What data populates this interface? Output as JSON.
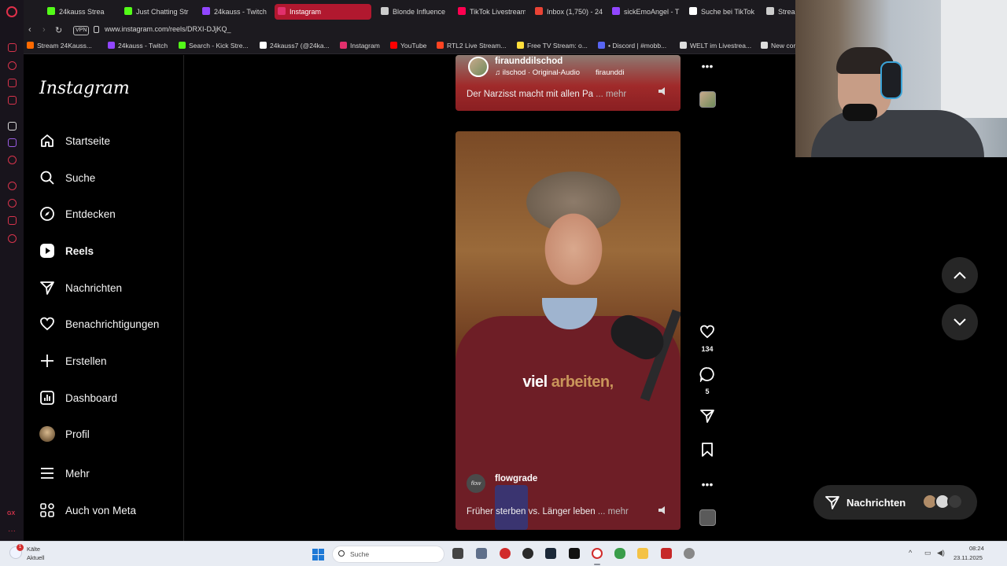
{
  "browser": {
    "tabs": [
      {
        "label": "24kauss Strea",
        "color": "#53fc18"
      },
      {
        "label": "Just Chatting Str",
        "color": "#53fc18"
      },
      {
        "label": "24kauss - Twitch",
        "color": "#9146ff"
      },
      {
        "label": "Instagram",
        "color": "#e1306c"
      },
      {
        "label": "Blonde Influence",
        "color": "#cccccc"
      },
      {
        "label": "TikTok Livestream",
        "color": "#ff0050"
      },
      {
        "label": "Inbox (1,750) - 24",
        "color": "#ea4335"
      },
      {
        "label": "sickEmoAngel - T",
        "color": "#9146ff"
      },
      {
        "label": "Suche bei TikTok",
        "color": "#ffffff"
      },
      {
        "label": "Strea",
        "color": "#cccccc"
      }
    ],
    "vpn": "VPN",
    "url": "www.instagram.com/reels/DRXI-DJjKQ_",
    "bookmarks": [
      {
        "label": "Stream 24Kauss...",
        "color": "#ff6a00"
      },
      {
        "label": "24kauss - Twitch",
        "color": "#9146ff"
      },
      {
        "label": "Search - Kick Stre...",
        "color": "#53fc18"
      },
      {
        "label": "24kauss7 (@24ka...",
        "color": "#ffffff"
      },
      {
        "label": "Instagram",
        "color": "#e1306c"
      },
      {
        "label": "YouTube",
        "color": "#ff0000"
      },
      {
        "label": "RTL2 Live Stream...",
        "color": "#ff4422"
      },
      {
        "label": "Free TV Stream: o...",
        "color": "#ffde3b"
      },
      {
        "label": "• Discord | #mobb...",
        "color": "#5865f2"
      },
      {
        "label": "WELT im Livestrea...",
        "color": "#dddddd"
      },
      {
        "label": "New cor",
        "color": "#dddddd"
      }
    ]
  },
  "instagram": {
    "logo": "Instagram",
    "nav": [
      {
        "label": "Startseite",
        "icon": "home-icon"
      },
      {
        "label": "Suche",
        "icon": "search-icon"
      },
      {
        "label": "Entdecken",
        "icon": "compass-icon"
      },
      {
        "label": "Reels",
        "icon": "reels-icon"
      },
      {
        "label": "Nachrichten",
        "icon": "send-icon"
      },
      {
        "label": "Benachrichtigungen",
        "icon": "heart-icon"
      },
      {
        "label": "Erstellen",
        "icon": "plus-icon"
      },
      {
        "label": "Dashboard",
        "icon": "dashboard-icon"
      },
      {
        "label": "Profil",
        "icon": "avatar-icon"
      },
      {
        "label": "Mehr",
        "icon": "menu-icon"
      },
      {
        "label": "Auch von Meta",
        "icon": "meta-icon"
      }
    ],
    "prev_reel": {
      "account": "firaunddilschod",
      "audio": "ilschod · Original-Audio",
      "audio_tail": "firaunddi",
      "description": "Der Narzisst macht mit allen Pa",
      "more": "... mehr"
    },
    "current_reel": {
      "caption_word1": "viel",
      "caption_word2": "arbeiten,",
      "account": "flowgrade",
      "account_avatar_text": "flow",
      "description": "Früher sterben vs. Länger leben",
      "more": "... mehr",
      "likes": "134",
      "comments": "5"
    },
    "messages_label": "Nachrichten"
  },
  "taskbar": {
    "weather_badge": "1",
    "weather_line1": "Kälte",
    "weather_line2": "Aktuell",
    "search_placeholder": "Suche",
    "time": "08:24",
    "date": "23.11.2025"
  }
}
